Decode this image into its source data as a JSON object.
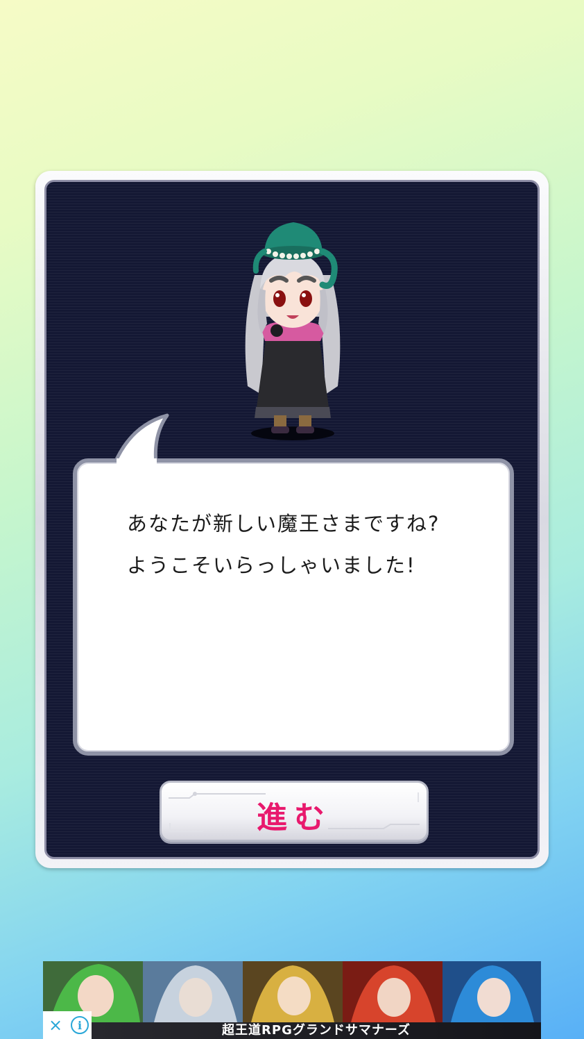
{
  "dialog": {
    "message_lines": "あなたが新しい魔王さまですね?\nようこそいらっしゃいました!",
    "character_name": "guide-girl",
    "proceed_label": "進む"
  },
  "ad": {
    "caption": "超王道RPGグランドサマナーズ",
    "close_icon": "×",
    "info_icon": "i"
  },
  "colors": {
    "panel_background": "#141834",
    "button_text": "#e8196d",
    "ad_control": "#29a7d8"
  }
}
